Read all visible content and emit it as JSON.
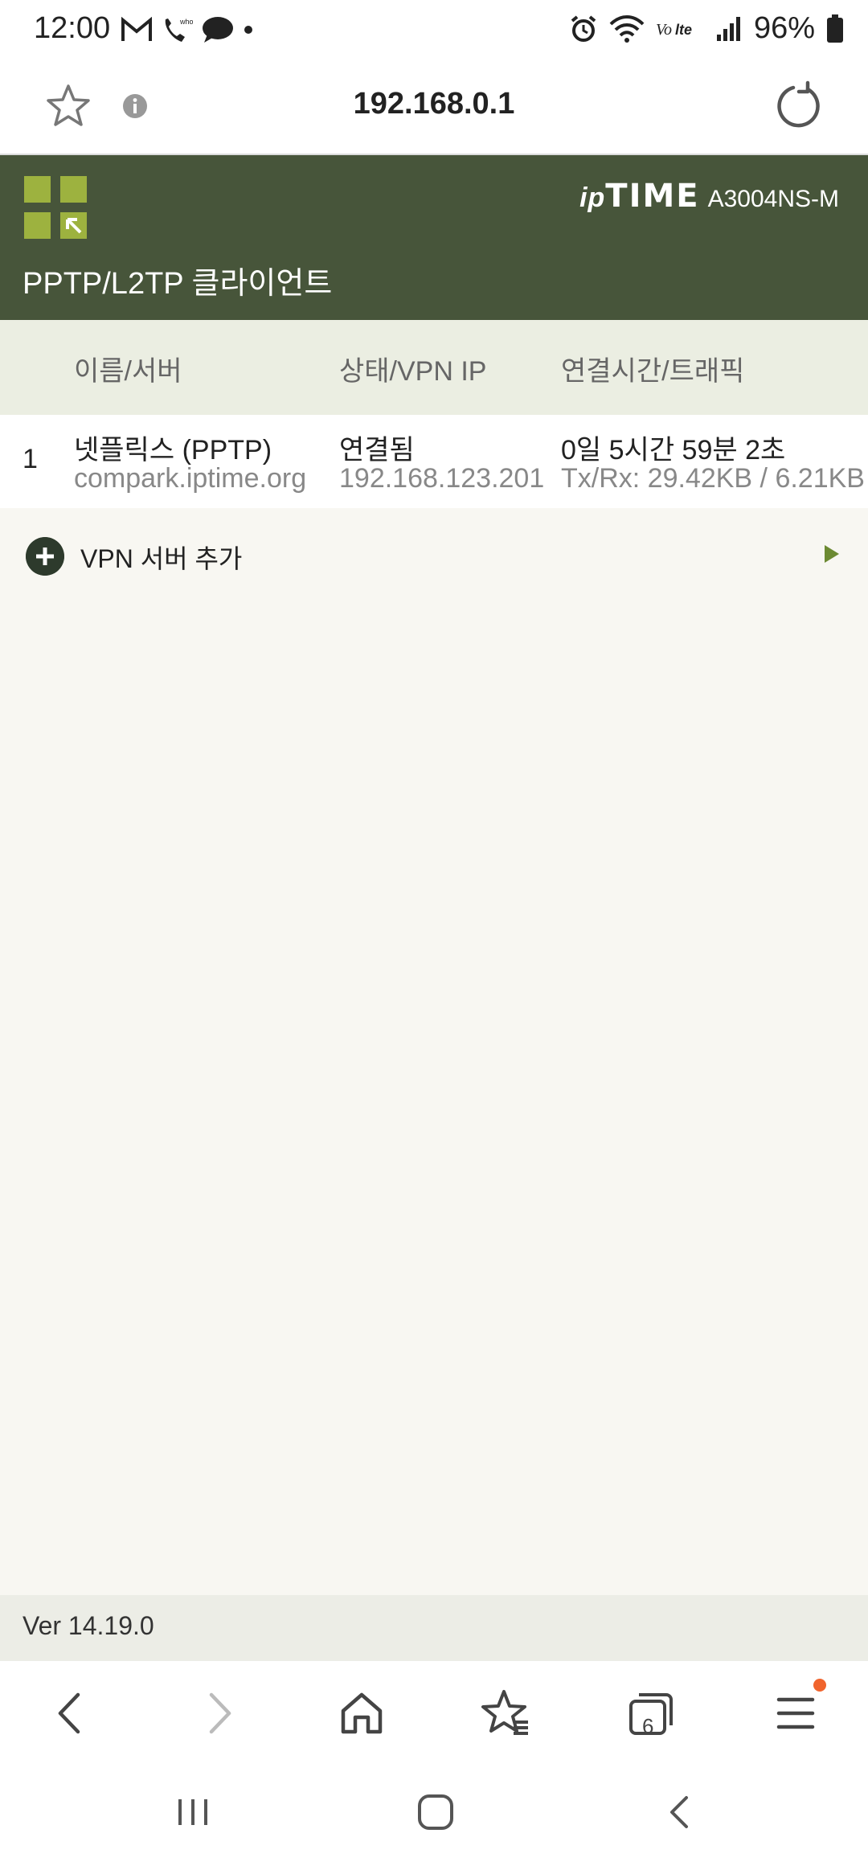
{
  "status_bar": {
    "time": "12:00",
    "battery_percent": "96%",
    "icons": [
      "gmail-icon",
      "wifi-calling-icon",
      "chat-bubble-icon",
      "dot-icon",
      "alarm-icon",
      "wifi-icon",
      "volte-icon",
      "signal-icon",
      "battery-icon"
    ]
  },
  "url_bar": {
    "url": "192.168.0.1"
  },
  "router": {
    "brand_ip": "ip",
    "brand_time": "TIME",
    "model": "A3004NS-M",
    "page_title": "PPTP/L2TP 클라이언트",
    "accent_color": "#47553a",
    "logo_color": "#9db23f"
  },
  "table": {
    "headers": [
      "이름/서버",
      "상태/VPN IP",
      "연결시간/트래픽"
    ],
    "rows": [
      {
        "index": "1",
        "name": "넷플릭스 (PPTP)",
        "server": "compark.iptime.org",
        "status": "연결됨",
        "vpn_ip": "192.168.123.201",
        "uptime": "0일 5시간 59분 2초",
        "traffic": "Tx/Rx: 29.42KB / 6.21KB"
      }
    ]
  },
  "add_server": {
    "label": "VPN 서버 추가"
  },
  "footer": {
    "version": "Ver 14.19.0"
  },
  "browser_nav": {
    "tab_count": "6"
  }
}
